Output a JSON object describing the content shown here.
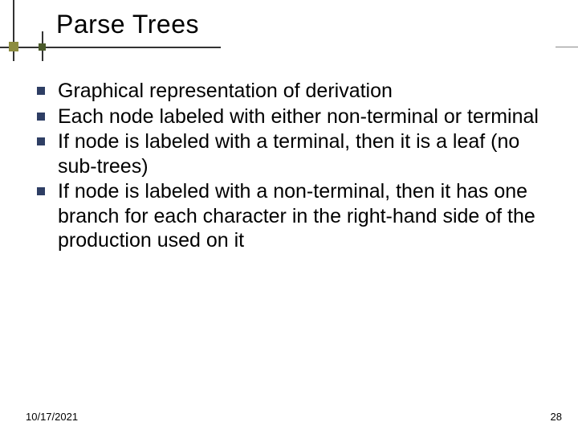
{
  "title": "Parse Trees",
  "bullets": [
    "Graphical representation of derivation",
    "Each node labeled with either non-terminal or terminal",
    "If node is labeled with a terminal, then it is a leaf (no sub-trees)",
    "If node is labeled with a non-terminal, then it has one branch for each character in the right-hand side of the production used on it"
  ],
  "footer": {
    "date": "10/17/2021",
    "page": "28"
  }
}
